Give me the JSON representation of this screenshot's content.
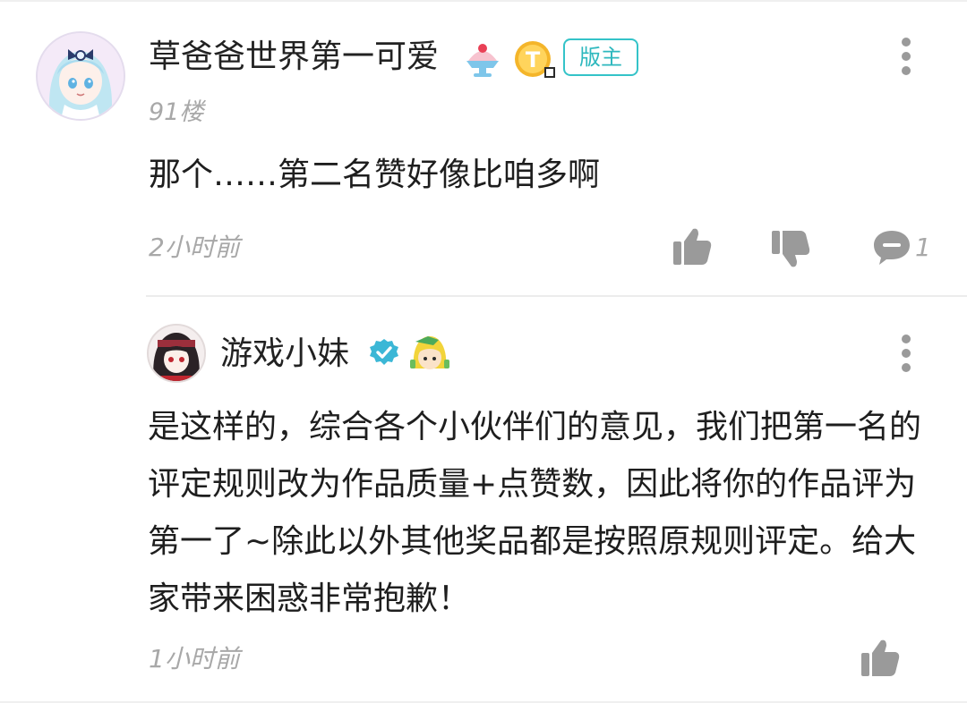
{
  "comments": [
    {
      "username": "草爸爸世界第一可爱",
      "badge": "版主",
      "floor": "91楼",
      "content": "那个……第二名赞好像比咱多啊",
      "time": "2小时前",
      "reply_count": "1"
    },
    {
      "username": "游戏小妹",
      "content": "是这样的，综合各个小伙伴们的意见，我们把第一名的评定规则改为作品质量+点赞数，因此将你的作品评为第一了~除此以外其他奖品都是按照原规则评定。给大家带来困惑非常抱歉！",
      "time": "1小时前"
    }
  ],
  "colors": {
    "accent": "#2eb8be",
    "muted": "#a8a8a8",
    "icon": "#9a9a9a",
    "gold": "#f4b52a"
  },
  "icons": [
    "avatar-anime-girl",
    "shaved-ice-emoji-icon",
    "coin-t-icon",
    "verified-icon",
    "character-badge-icon",
    "thumbs-up-icon",
    "thumbs-down-icon",
    "comment-icon",
    "more-vertical-icon"
  ]
}
